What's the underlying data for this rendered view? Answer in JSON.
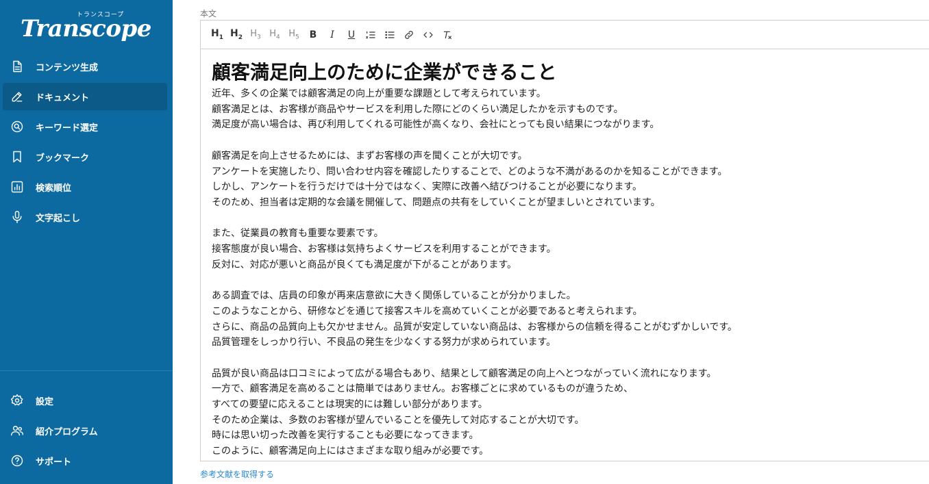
{
  "brand": {
    "logo_main": "Transcope",
    "logo_sub": "トランスコープ"
  },
  "sidebar": {
    "items": [
      {
        "label": "コンテンツ生成",
        "icon": "document-icon"
      },
      {
        "label": "ドキュメント",
        "icon": "edit-icon",
        "active": true
      },
      {
        "label": "キーワード選定",
        "icon": "search-circle-icon"
      },
      {
        "label": "ブックマーク",
        "icon": "bookmark-icon"
      },
      {
        "label": "検索順位",
        "icon": "bar-chart-icon"
      },
      {
        "label": "文字起こし",
        "icon": "microphone-icon"
      }
    ],
    "bottom_items": [
      {
        "label": "設定",
        "icon": "gear-icon"
      },
      {
        "label": "紹介プログラム",
        "icon": "users-icon"
      },
      {
        "label": "サポート",
        "icon": "help-icon"
      }
    ],
    "bg_color": "#0d6aa0",
    "active_color": "#0b5a88"
  },
  "editor": {
    "field_label": "本文",
    "toolbar": [
      "H1",
      "H2",
      "H3",
      "H4",
      "H5",
      "bold",
      "italic",
      "underline",
      "ordered-list",
      "bullet-list",
      "link",
      "code",
      "clear-format"
    ],
    "title": "顧客満足向上のために企業ができること",
    "paragraphs": [
      [
        "近年、多くの企業では顧客満足の向上が重要な課題として考えられています。",
        "顧客満足とは、お客様が商品やサービスを利用した際にどのくらい満足したかを示すものです。",
        "満足度が高い場合は、再び利用してくれる可能性が高くなり、会社にとっても良い結果につながります。"
      ],
      [
        "顧客満足を向上させるためには、まずお客様の声を聞くことが大切です。",
        "アンケートを実施したり、問い合わせ内容を確認したりすることで、どのような不満があるのかを知ることができます。",
        "しかし、アンケートを行うだけでは十分ではなく、実際に改善へ結びつけることが必要になります。",
        "そのため、担当者は定期的な会議を開催して、問題点の共有をしていくことが望ましいとされています。"
      ],
      [
        "また、従業員の教育も重要な要素です。",
        "接客態度が良い場合、お客様は気持ちよくサービスを利用することができます。",
        "反対に、対応が悪いと商品が良くても満足度が下がることがあります。"
      ],
      [
        "ある調査では、店員の印象が再来店意欲に大きく関係していることが分かりました。",
        "このようなことから、研修などを通じて接客スキルを高めていくことが必要であると考えられます。",
        "さらに、商品の品質向上も欠かせません。品質が安定していない商品は、お客様からの信頼を得ることがむずかしいです。",
        "品質管理をしっかり行い、不良品の発生を少なくする努力が求められています。"
      ],
      [
        "品質が良い商品は口コミによって広がる場合もあり、結果として顧客満足の向上へとつながっていく流れになります。",
        "一方で、顧客満足を高めることは簡単ではありません。お客様ごとに求めているものが違うため、",
        "すべての要望に応えることは現実的には難しい部分があります。",
        "そのため企業は、多数のお客様が望んでいることを優先して対応することが大切です。",
        "時には思い切った改善を実行することも必要になってきます。",
        "このように、顧客満足向上にはさまざまな取り組みが必要です。"
      ]
    ]
  },
  "reference_link": "参考文献を取得する"
}
